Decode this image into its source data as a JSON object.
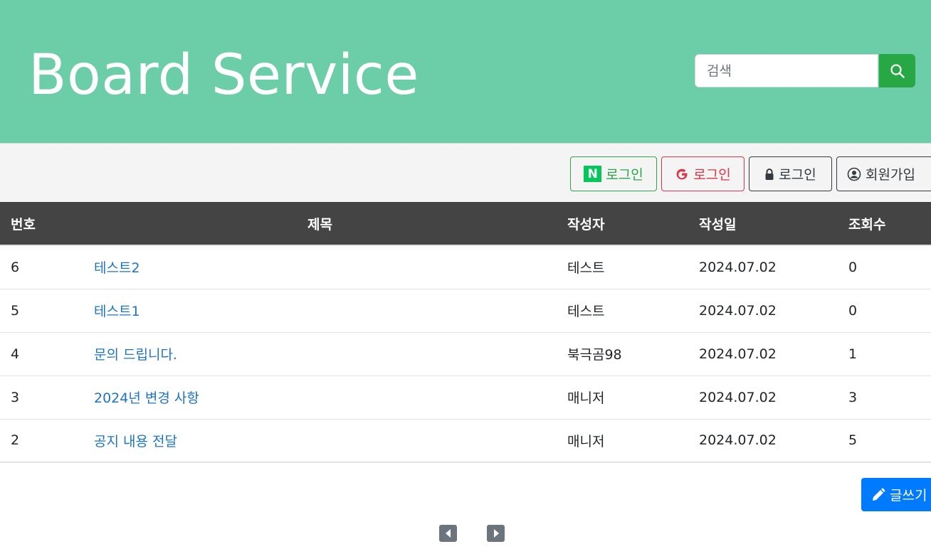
{
  "header": {
    "title": "Board Service",
    "search_placeholder": "검색",
    "bg_color": "#6ccea9"
  },
  "auth": {
    "naver_icon": "N",
    "naver_login": "로그인",
    "google_login": "로그인",
    "login": "로그인",
    "signup": "회원가입"
  },
  "table": {
    "headers": [
      "번호",
      "제목",
      "작성자",
      "작성일",
      "조회수"
    ],
    "rows": [
      {
        "no": "6",
        "title": "테스트2",
        "author": "테스트",
        "date": "2024.07.02",
        "views": "0"
      },
      {
        "no": "5",
        "title": "테스트1",
        "author": "테스트",
        "date": "2024.07.02",
        "views": "0"
      },
      {
        "no": "4",
        "title": "문의 드립니다.",
        "author": "북극곰98",
        "date": "2024.07.02",
        "views": "1"
      },
      {
        "no": "3",
        "title": "2024년 변경 사항",
        "author": "매니저",
        "date": "2024.07.02",
        "views": "3"
      },
      {
        "no": "2",
        "title": "공지 내용 전달",
        "author": "매니저",
        "date": "2024.07.02",
        "views": "5"
      }
    ]
  },
  "write_button": "글쓰기",
  "icons": {
    "search": "search-icon",
    "google": "google-icon",
    "lock": "lock-icon",
    "user": "user-circle-icon",
    "pencil": "pencil-icon",
    "prev": "caret-left-icon",
    "next": "caret-right-icon"
  }
}
